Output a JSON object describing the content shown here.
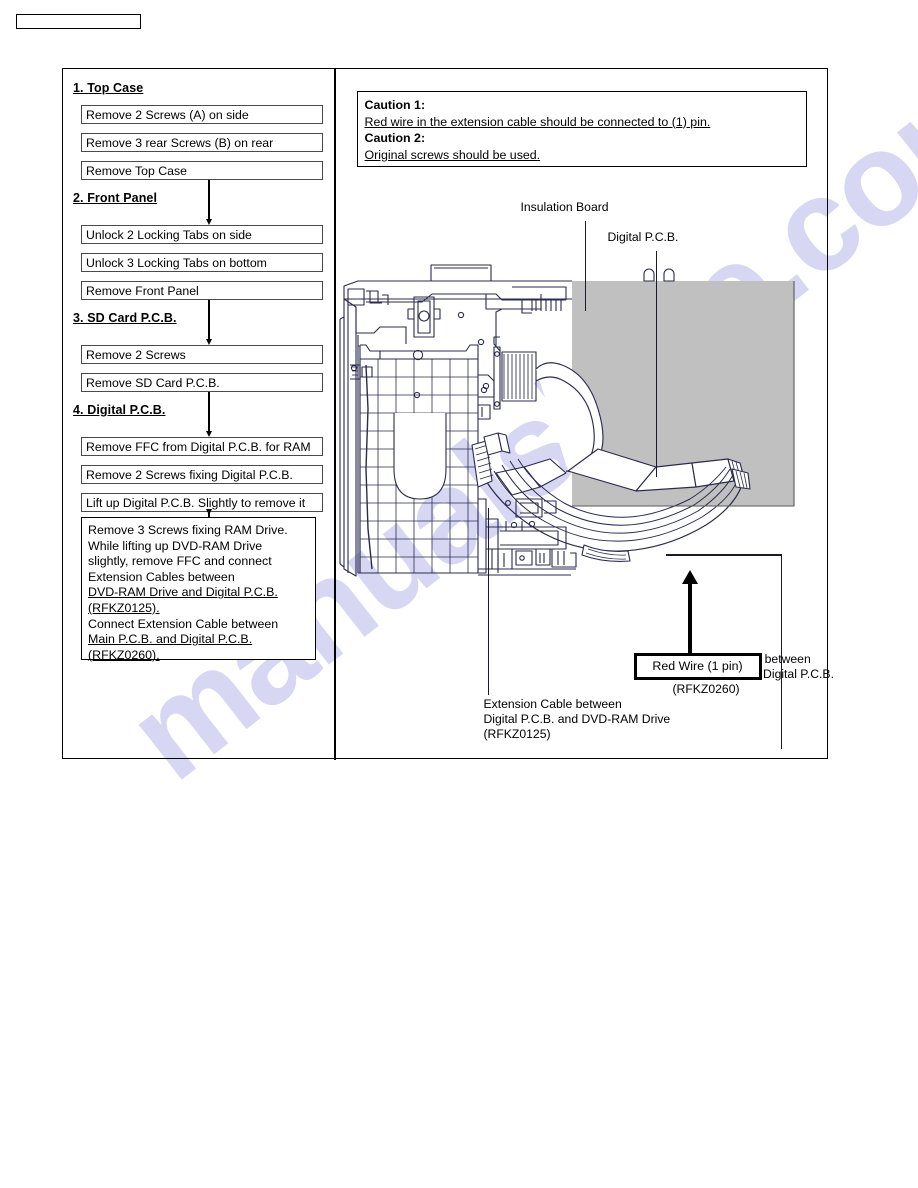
{
  "header": {
    "placeholder_label": ""
  },
  "watermark": {
    "text": "manualshive.com",
    "color": "#c8c8f0"
  },
  "colors": {
    "ink": "#000000",
    "insulation_board_gray": "#c0c0c0",
    "line_art_stroke": "#2b2b4f",
    "box_border": "#4a4a4a"
  },
  "flow": {
    "sections": [
      {
        "heading": "1. Top Case",
        "steps": [
          "Remove 2 Screws (A) on side",
          "Remove 3 rear Screws (B) on rear",
          "Remove Top Case"
        ]
      },
      {
        "heading": "2. Front Panel",
        "steps": [
          "Unlock 2 Locking Tabs on side",
          "Unlock 3 Locking Tabs on bottom",
          "Remove Front Panel"
        ]
      },
      {
        "heading": "3. SD Card P.C.B.",
        "steps": [
          "Remove 2 Screws",
          "Remove SD Card P.C.B."
        ]
      },
      {
        "heading": "4. Digital P.C.B.",
        "steps": [
          "Remove FFC from Digital P.C.B. for RAM",
          "Remove 2 Screws fixing Digital P.C.B.",
          "Lift up Digital P.C.B. Slightly to remove it"
        ]
      }
    ],
    "note": {
      "lines": [
        {
          "text": "Remove 3  Screws fixing RAM Drive.",
          "underline": false
        },
        {
          "text": "While lifting up DVD-RAM Drive",
          "underline": false
        },
        {
          "text": "slightly, remove FFC and connect",
          "underline": false
        },
        {
          "text": "Extension Cables between",
          "underline": false
        },
        {
          "text": "DVD-RAM Drive and Digital P.C.B.",
          "underline": true
        },
        {
          "text": "(RFKZ0125).",
          "underline": true
        },
        {
          "text": "Connect Extension Cable between",
          "underline": false
        },
        {
          "text": "Main P.C.B. and Digital P.C.B.",
          "underline": true
        },
        {
          "text": "(RFKZ0260).",
          "underline": true
        }
      ]
    }
  },
  "cautions": [
    {
      "heading": "Caution 1:",
      "body": "Red wire in the extension cable should be connected to (1) pin."
    },
    {
      "heading": "Caution 2:",
      "body": "Original screws should be used."
    }
  ],
  "diagram": {
    "labels": {
      "insulation_board": "Insulation Board",
      "digital_pcb": "Digital P.C.B.",
      "red_wire": "Red Wire (1 pin)",
      "ext_cable_ram": [
        "Extension Cable between",
        "Digital P.C.B. and DVD-RAM Drive",
        "(RFKZ0125)"
      ],
      "ext_cable_main": [
        "Extension Cable between",
        "Main P.C.B. and Digital P.C.B.",
        "(RFKZ0260)"
      ]
    }
  }
}
